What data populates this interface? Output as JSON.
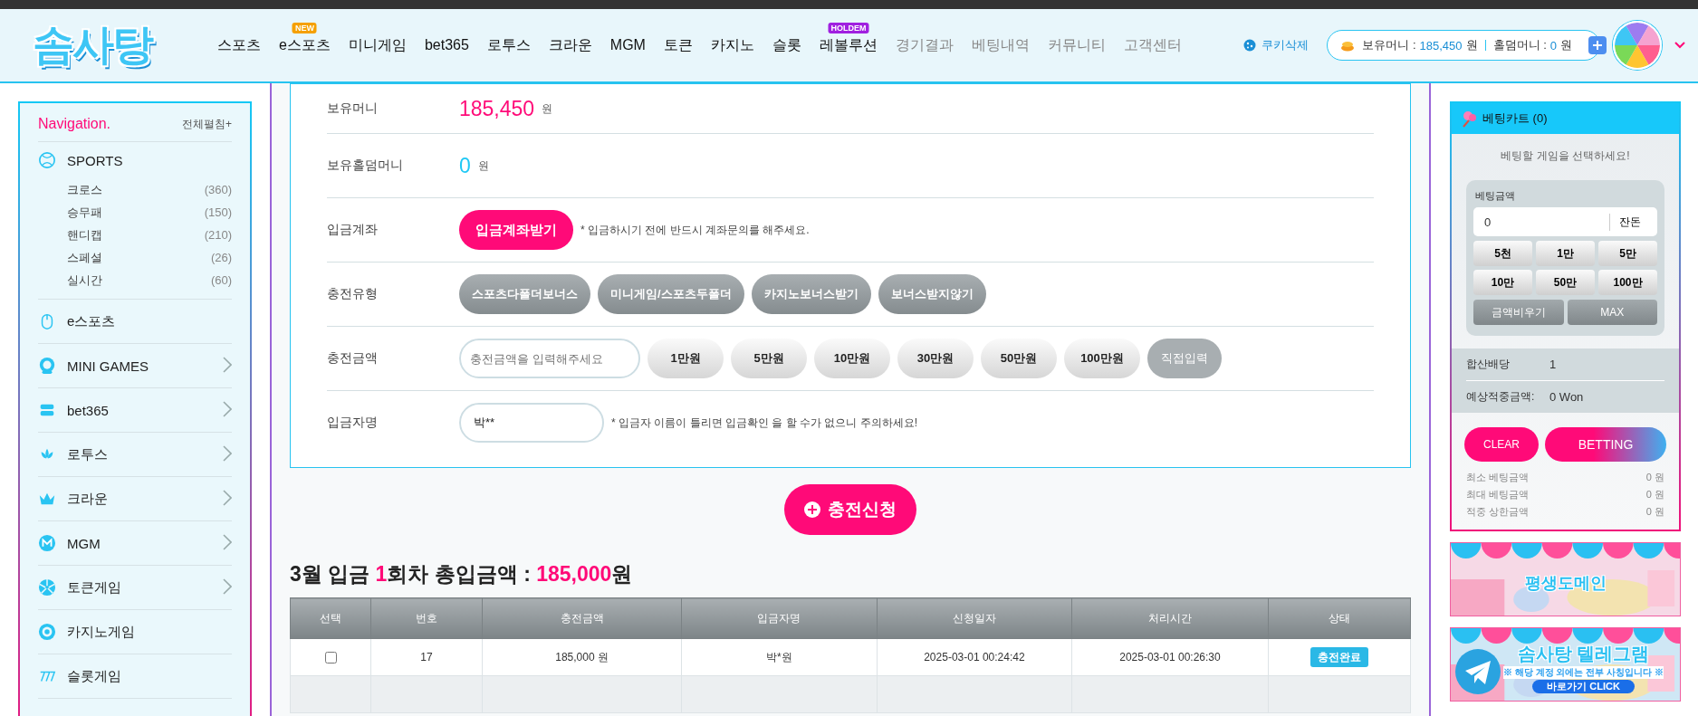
{
  "header": {
    "logo": "솜사탕",
    "nav": [
      {
        "label": "스포츠",
        "muted": false
      },
      {
        "label": "e스포츠",
        "muted": false,
        "badge": {
          "text": "NEW",
          "color": "#f5a000"
        }
      },
      {
        "label": "미니게임",
        "muted": false
      },
      {
        "label": "bet365",
        "muted": false
      },
      {
        "label": "로투스",
        "muted": false
      },
      {
        "label": "크라운",
        "muted": false
      },
      {
        "label": "MGM",
        "muted": false
      },
      {
        "label": "토큰",
        "muted": false
      },
      {
        "label": "카지노",
        "muted": false
      },
      {
        "label": "슬롯",
        "muted": false
      },
      {
        "label": "레볼루션",
        "muted": false,
        "badge": {
          "text": "HOLDEM",
          "color": "#a020e0"
        }
      },
      {
        "label": "경기결과",
        "muted": true
      },
      {
        "label": "베팅내역",
        "muted": true
      },
      {
        "label": "커뮤니티",
        "muted": true
      },
      {
        "label": "고객센터",
        "muted": true
      }
    ],
    "cookie": "쿠키삭제",
    "wallet": [
      {
        "label": "보유머니 :",
        "value": "185,450",
        "unit": "원"
      },
      {
        "label": "홀덤머니 :",
        "value": "0",
        "unit": "원"
      }
    ]
  },
  "sidebar": {
    "title": "Navigation.",
    "expand_all": "전체펼침+",
    "items": [
      {
        "label": "SPORTS",
        "has_submenu": false,
        "children": [
          {
            "label": "크로스",
            "count": "(360)"
          },
          {
            "label": "승무패",
            "count": "(150)"
          },
          {
            "label": "핸디캡",
            "count": "(210)"
          },
          {
            "label": "스페셜",
            "count": "(26)"
          },
          {
            "label": "실시간",
            "count": "(60)"
          }
        ]
      },
      {
        "label": "e스포츠",
        "has_submenu": false
      },
      {
        "label": "MINI GAMES",
        "has_submenu": true
      },
      {
        "label": "bet365",
        "has_submenu": true
      },
      {
        "label": "로투스",
        "has_submenu": true
      },
      {
        "label": "크라운",
        "has_submenu": true
      },
      {
        "label": "MGM",
        "has_submenu": true
      },
      {
        "label": "토큰게임",
        "has_submenu": true
      },
      {
        "label": "카지노게임",
        "has_submenu": false
      },
      {
        "label": "슬롯게임",
        "has_submenu": false
      }
    ]
  },
  "form": {
    "rows": [
      {
        "label": "보유머니",
        "kind": "money",
        "value": "185,450",
        "unit": "원",
        "color": "#ff0a78"
      },
      {
        "label": "보유홀덤머니",
        "kind": "money",
        "value": "0",
        "unit": "원",
        "color": "#1ec8f5"
      },
      {
        "label": "입금계좌",
        "kind": "action",
        "button": "입금계좌받기",
        "note": "* 입금하시기 전에 반드시 계좌문의를 해주세요."
      },
      {
        "label": "충전유형",
        "kind": "options",
        "options": [
          {
            "label": "스포츠다폴더보너스",
            "selected": false
          },
          {
            "label": "미니게임/스포츠두폴더",
            "selected": false
          },
          {
            "label": "카지노보너스받기",
            "selected": false
          },
          {
            "label": "보너스받지않기",
            "selected": false
          }
        ]
      },
      {
        "label": "충전금액",
        "kind": "amount",
        "placeholder": "충전금액을 입력해주세요",
        "buttons": [
          "1만원",
          "5만원",
          "10만원",
          "30만원",
          "50만원",
          "100만원"
        ],
        "custom": "직접입력"
      },
      {
        "label": "입금자명",
        "kind": "name",
        "value": "박**",
        "note": "* 입금자 이름이 틀리면 입금확인 을 할 수가 없으니 주의하세요!"
      }
    ],
    "submit": "충전신청"
  },
  "summary": "3월 입금 **1**회차 총입금액 : **185,000**원",
  "table": {
    "columns": [
      "선택",
      "번호",
      "충전금액",
      "입금자명",
      "신청일자",
      "처리시간",
      "상태"
    ],
    "rows": [
      {
        "checked": false,
        "cells": [
          "",
          "17",
          "185,000 원",
          "박*원",
          "2025-03-01 00:24:42",
          "2025-03-01 00:26:30",
          "충전완료"
        ]
      }
    ]
  },
  "cart": {
    "title": "베팅카트 (0)",
    "hint": "베팅할 게임을 선택하세요!",
    "amount_label": "베팅금액",
    "amount": "0",
    "change": "잔돈",
    "chips": [
      "5천",
      "1만",
      "5만",
      "10만",
      "50만",
      "100만"
    ],
    "clear_amount": "금액비우기",
    "max": "MAX",
    "stats": [
      {
        "label": "합산배당",
        "value": "1"
      },
      {
        "label": "예상적중금액:",
        "value": "0 Won"
      }
    ],
    "clear": "CLEAR",
    "bet": "BETTING",
    "limits": [
      {
        "label": "최소 베팅금액",
        "value": "0 원"
      },
      {
        "label": "최대 베팅금액",
        "value": "0 원"
      },
      {
        "label": "적중 상한금액",
        "value": "0 원"
      }
    ]
  },
  "banners": [
    {
      "kind": "domain",
      "title": "평생도메인"
    },
    {
      "kind": "telegram",
      "title": "솜사탕 텔레그램",
      "subtitle": "※ 해당 계정 외에는 전부 사칭입니다 ※",
      "button": "바로가기 CLICK"
    }
  ]
}
